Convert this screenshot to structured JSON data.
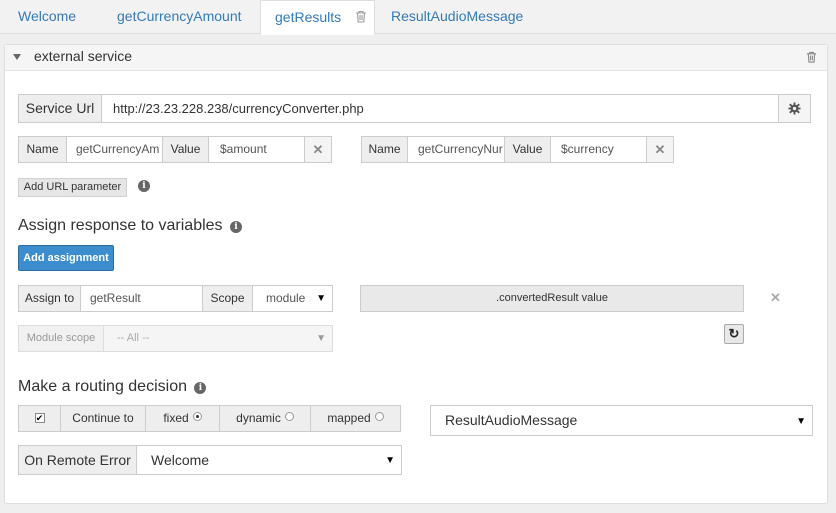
{
  "tabs": [
    {
      "label": "Welcome"
    },
    {
      "label": "getCurrencyAmount"
    },
    {
      "label": "getResults",
      "active": true
    },
    {
      "label": "ResultAudioMessage"
    }
  ],
  "panel": {
    "title": "external service"
  },
  "service": {
    "label": "Service Url",
    "url": "http://23.23.228.238/currencyConverter.php"
  },
  "params": [
    {
      "name_label": "Name",
      "name_value": "getCurrencyAm",
      "value_label": "Value",
      "value": "$amount"
    },
    {
      "name_label": "Name",
      "name_value": "getCurrencyNur",
      "value_label": "Value",
      "value": "$currency"
    }
  ],
  "add_url_param_label": "Add URL parameter",
  "assign": {
    "heading": "Assign response to variables",
    "add_label": "Add assignment",
    "assign_to_label": "Assign to",
    "assign_to_value": "getResult",
    "scope_label": "Scope",
    "scope_value": "module",
    "expression": ".convertedResult value",
    "module_scope_label": "Module scope",
    "module_scope_value": "-- All --"
  },
  "routing": {
    "heading": "Make a routing decision",
    "continue_label": "Continue to",
    "options": [
      {
        "label": "fixed",
        "selected": true
      },
      {
        "label": "dynamic",
        "selected": false
      },
      {
        "label": "mapped",
        "selected": false
      }
    ],
    "target": "ResultAudioMessage",
    "on_error_label": "On Remote Error",
    "on_error_value": "Welcome"
  },
  "icons": {
    "delete": "trash-icon",
    "settings": "gear-icon",
    "info": "info-icon",
    "remove": "close-icon",
    "reset": "undo-icon"
  }
}
